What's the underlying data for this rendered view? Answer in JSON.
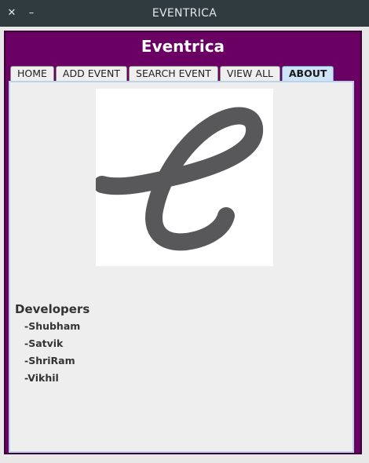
{
  "window": {
    "title": "EVENTRICA",
    "close_glyph": "✕",
    "minimize_glyph": "–"
  },
  "app": {
    "title": "Eventrica"
  },
  "tabs": [
    {
      "label": "HOME",
      "active": false
    },
    {
      "label": "ADD EVENT",
      "active": false
    },
    {
      "label": "SEARCH EVENT",
      "active": false
    },
    {
      "label": "VIEW ALL",
      "active": false
    },
    {
      "label": "ABOUT",
      "active": true
    }
  ],
  "about": {
    "logo_icon": "eventrica-e-logo",
    "logo_color": "#58585a",
    "developers_heading": "Developers",
    "developers": [
      "-Shubham",
      "-Satvik",
      "-ShriRam",
      "-Vikhil"
    ]
  },
  "colors": {
    "frame": "#6a0064",
    "titlebar": "#2f3b3f",
    "active_tab": "#cfe4f7"
  }
}
